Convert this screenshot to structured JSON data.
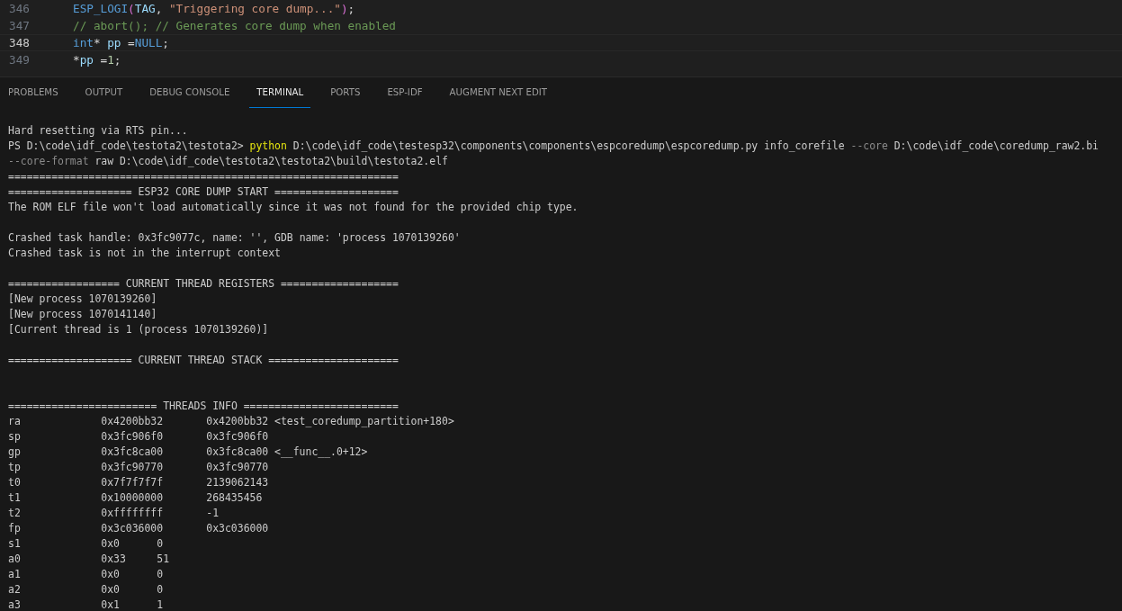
{
  "editor": {
    "lines": [
      {
        "number": "346",
        "current": false,
        "tokens": [
          {
            "kind": "macro",
            "text": "ESP_LOGI"
          },
          {
            "kind": "bracket",
            "text": "("
          },
          {
            "kind": "var",
            "text": "TAG"
          },
          {
            "kind": "plain",
            "text": ", "
          },
          {
            "kind": "string",
            "text": "\"Triggering core dump...\""
          },
          {
            "kind": "bracket",
            "text": ")"
          },
          {
            "kind": "plain",
            "text": ";"
          }
        ]
      },
      {
        "number": "347",
        "current": false,
        "tokens": [
          {
            "kind": "comment",
            "text": "// abort(); // Generates core dump when enabled"
          }
        ]
      },
      {
        "number": "348",
        "current": true,
        "tokens": [
          {
            "kind": "keyword",
            "text": "int"
          },
          {
            "kind": "plain",
            "text": "* "
          },
          {
            "kind": "var",
            "text": "pp"
          },
          {
            "kind": "plain",
            "text": " ="
          },
          {
            "kind": "keyword",
            "text": "NULL"
          },
          {
            "kind": "plain",
            "text": ";"
          }
        ]
      },
      {
        "number": "349",
        "current": false,
        "tokens": [
          {
            "kind": "plain",
            "text": "*"
          },
          {
            "kind": "var",
            "text": "pp"
          },
          {
            "kind": "plain",
            "text": " ="
          },
          {
            "kind": "number",
            "text": "1"
          },
          {
            "kind": "plain",
            "text": ";"
          }
        ]
      }
    ]
  },
  "panel_tabs": [
    {
      "label": "PROBLEMS",
      "selected": false
    },
    {
      "label": "OUTPUT",
      "selected": false
    },
    {
      "label": "DEBUG CONSOLE",
      "selected": false
    },
    {
      "label": "TERMINAL",
      "selected": true
    },
    {
      "label": "PORTS",
      "selected": false
    },
    {
      "label": "ESP-IDF",
      "selected": false
    },
    {
      "label": "AUGMENT NEXT EDIT",
      "selected": false
    }
  ],
  "terminal": {
    "lines": [
      {
        "kind": "blank"
      },
      {
        "kind": "text",
        "segments": [
          {
            "kind": "plain",
            "text": "Hard resetting via RTS pin..."
          }
        ]
      },
      {
        "kind": "text",
        "segments": [
          {
            "kind": "plain",
            "text": "PS D:\\code\\idf_code\\testota2\\testota2> "
          },
          {
            "kind": "command",
            "text": "python"
          },
          {
            "kind": "plain",
            "text": " D:\\code\\idf_code\\testesp32\\components\\components\\espcoredump\\espcoredump.py info_corefile "
          },
          {
            "kind": "flag",
            "text": "--core"
          },
          {
            "kind": "plain",
            "text": " D:\\code\\idf_code\\coredump_raw2.bi"
          }
        ]
      },
      {
        "kind": "text",
        "segments": [
          {
            "kind": "flag",
            "text": "--core-format"
          },
          {
            "kind": "plain",
            "text": " raw D:\\code\\idf_code\\testota2\\testota2\\build\\testota2.elf"
          }
        ]
      },
      {
        "kind": "text",
        "segments": [
          {
            "kind": "plain",
            "text": "==============================================================="
          }
        ]
      },
      {
        "kind": "text",
        "segments": [
          {
            "kind": "plain",
            "text": "==================== ESP32 CORE DUMP START ===================="
          }
        ]
      },
      {
        "kind": "text",
        "segments": [
          {
            "kind": "plain",
            "text": "The ROM ELF file won't load automatically since it was not found for the provided chip type."
          }
        ]
      },
      {
        "kind": "blank"
      },
      {
        "kind": "text",
        "segments": [
          {
            "kind": "plain",
            "text": "Crashed task handle: 0x3fc9077c, name: '', GDB name: 'process 1070139260'"
          }
        ]
      },
      {
        "kind": "text",
        "segments": [
          {
            "kind": "plain",
            "text": "Crashed task is not in the interrupt context"
          }
        ]
      },
      {
        "kind": "blank"
      },
      {
        "kind": "text",
        "segments": [
          {
            "kind": "plain",
            "text": "================== CURRENT THREAD REGISTERS ==================="
          }
        ]
      },
      {
        "kind": "text",
        "segments": [
          {
            "kind": "plain",
            "text": "[New process 1070139260]"
          }
        ]
      },
      {
        "kind": "text",
        "segments": [
          {
            "kind": "plain",
            "text": "[New process 1070141140]"
          }
        ]
      },
      {
        "kind": "text",
        "segments": [
          {
            "kind": "plain",
            "text": "[Current thread is 1 (process 1070139260)]"
          }
        ]
      },
      {
        "kind": "blank"
      },
      {
        "kind": "text",
        "segments": [
          {
            "kind": "plain",
            "text": "==================== CURRENT THREAD STACK ====================="
          }
        ]
      },
      {
        "kind": "blank"
      },
      {
        "kind": "blank"
      },
      {
        "kind": "text",
        "segments": [
          {
            "kind": "plain",
            "text": "======================== THREADS INFO ========================="
          }
        ]
      },
      {
        "kind": "register",
        "name": "ra",
        "raw": "0x4200bb32",
        "natural": "0x4200bb32 <test_coredump_partition+180>"
      },
      {
        "kind": "register",
        "name": "sp",
        "raw": "0x3fc906f0",
        "natural": "0x3fc906f0"
      },
      {
        "kind": "register",
        "name": "gp",
        "raw": "0x3fc8ca00",
        "natural": "0x3fc8ca00 <__func__.0+12>"
      },
      {
        "kind": "register",
        "name": "tp",
        "raw": "0x3fc90770",
        "natural": "0x3fc90770"
      },
      {
        "kind": "register",
        "name": "t0",
        "raw": "0x7f7f7f7f",
        "natural": "2139062143"
      },
      {
        "kind": "register",
        "name": "t1",
        "raw": "0x10000000",
        "natural": "268435456"
      },
      {
        "kind": "register",
        "name": "t2",
        "raw": "0xffffffff",
        "natural": "-1"
      },
      {
        "kind": "register",
        "name": "fp",
        "raw": "0x3c036000",
        "natural": "0x3c036000"
      },
      {
        "kind": "register",
        "name": "s1",
        "raw": "0x0",
        "natural": "0"
      },
      {
        "kind": "register",
        "name": "a0",
        "raw": "0x33",
        "natural": "51"
      },
      {
        "kind": "register",
        "name": "a1",
        "raw": "0x0",
        "natural": "0"
      },
      {
        "kind": "register",
        "name": "a2",
        "raw": "0x0",
        "natural": "0"
      },
      {
        "kind": "register",
        "name": "a3",
        "raw": "0x1",
        "natural": "1"
      }
    ]
  }
}
